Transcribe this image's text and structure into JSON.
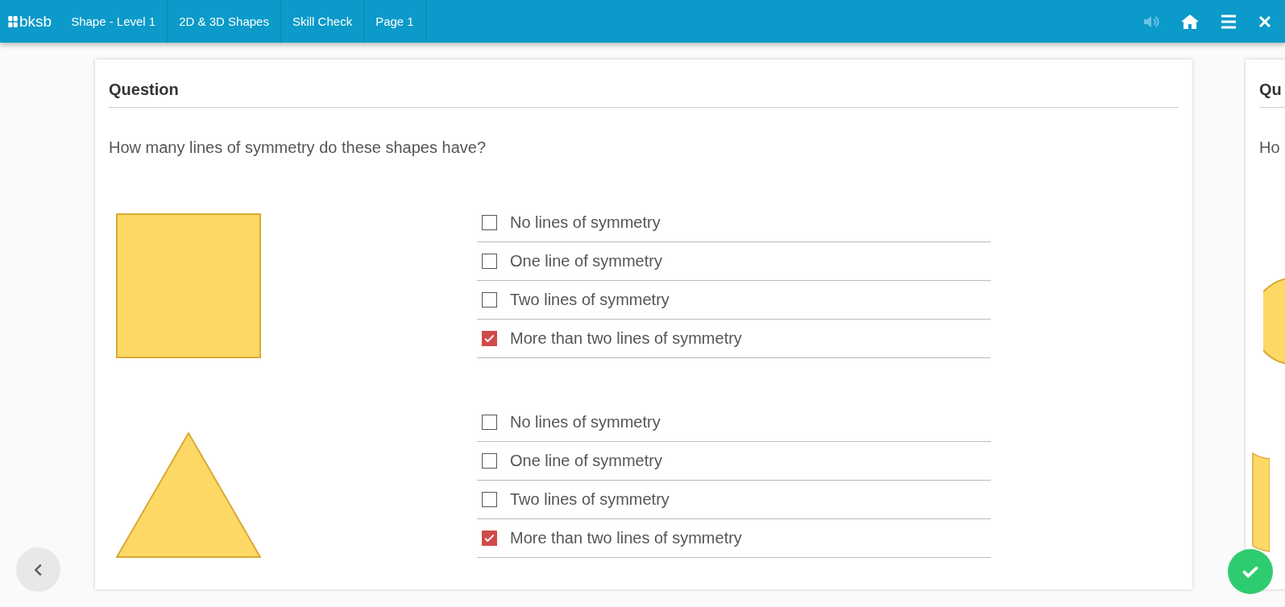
{
  "header": {
    "logo": "bksb",
    "breadcrumbs": [
      "Shape - Level 1",
      "2D & 3D Shapes",
      "Skill Check",
      "Page 1"
    ]
  },
  "card": {
    "title": "Question",
    "prompt": "How many lines of symmetry do these shapes have?",
    "items": [
      {
        "kind": "square",
        "options": [
          {
            "label": "No lines of symmetry",
            "checked": false
          },
          {
            "label": "One line of symmetry",
            "checked": false
          },
          {
            "label": "Two lines of symmetry",
            "checked": false
          },
          {
            "label": "More than two lines of symmetry",
            "checked": true
          }
        ]
      },
      {
        "kind": "triangle",
        "options": [
          {
            "label": "No lines of symmetry",
            "checked": false
          },
          {
            "label": "One line of symmetry",
            "checked": false
          },
          {
            "label": "Two lines of symmetry",
            "checked": false
          },
          {
            "label": "More than two lines of symmetry",
            "checked": true
          }
        ]
      }
    ]
  },
  "next_card": {
    "title": "Qu",
    "prompt": "Ho"
  }
}
